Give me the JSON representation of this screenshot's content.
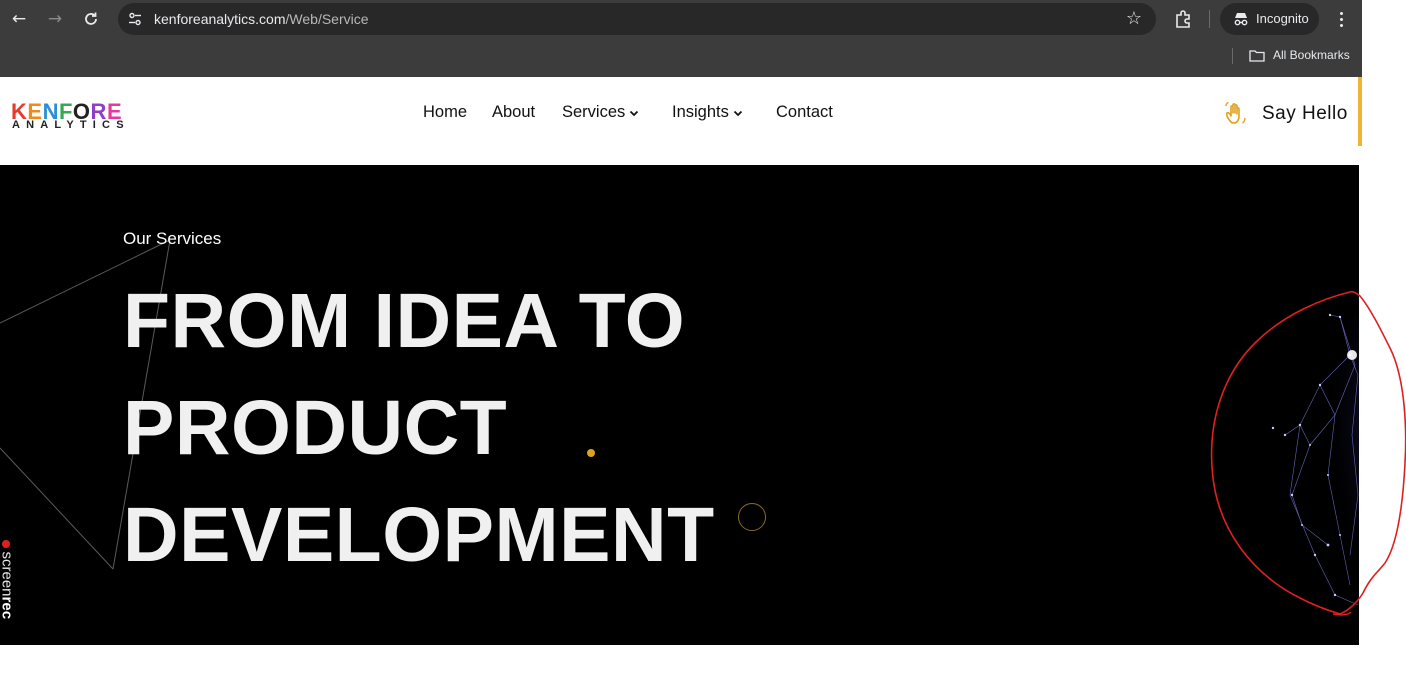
{
  "browser": {
    "url_domain": "kenforeanalytics.com",
    "url_path": "/Web/Service",
    "incognito_label": "Incognito",
    "bookmarks_label": "All Bookmarks",
    "icons": [
      "back-arrow-icon",
      "forward-arrow-icon",
      "reload-icon",
      "site-info-icon",
      "bookmark-star-icon",
      "extensions-icon",
      "incognito-icon",
      "more-menu-icon",
      "folder-icon"
    ]
  },
  "header": {
    "logo_top": "KENFORE",
    "logo_bottom": "ANALYTICS",
    "nav": [
      {
        "label": "Home"
      },
      {
        "label": "About"
      },
      {
        "label": "Services"
      },
      {
        "label": "Insights"
      },
      {
        "label": "Contact"
      }
    ],
    "cta_label": "Say Hello",
    "accent_color": "#f2b233"
  },
  "hero": {
    "eyebrow": "Our Services",
    "title_lines": [
      "FROM IDEA TO",
      "PRODUCT",
      "DEVELOPMENT"
    ],
    "background": "#000000",
    "accent_dot_color": "#e0a21d"
  },
  "overlay": {
    "recorder_brand_light": "screen",
    "recorder_brand_bold": "rec",
    "annotation_color": "#e02020"
  }
}
